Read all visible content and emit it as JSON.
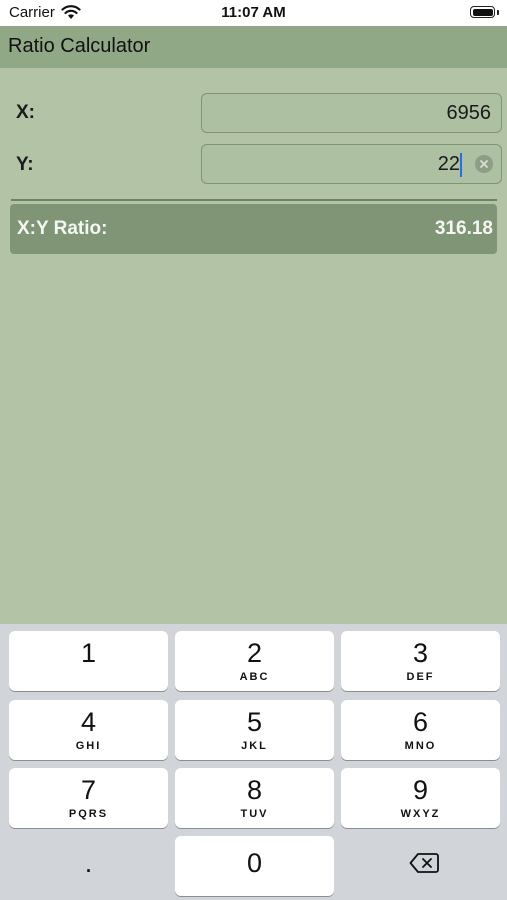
{
  "status_bar": {
    "carrier": "Carrier",
    "time": "11:07 AM"
  },
  "header": {
    "title": "Ratio Calculator"
  },
  "form": {
    "x": {
      "label": "X:",
      "value": "6956"
    },
    "y": {
      "label": "Y:",
      "value": "22"
    }
  },
  "result": {
    "label": "X:Y Ratio:",
    "value": "316.18"
  },
  "keyboard": {
    "keys": [
      {
        "num": "1",
        "letters": ""
      },
      {
        "num": "2",
        "letters": "ABC"
      },
      {
        "num": "3",
        "letters": "DEF"
      },
      {
        "num": "4",
        "letters": "GHI"
      },
      {
        "num": "5",
        "letters": "JKL"
      },
      {
        "num": "6",
        "letters": "MNO"
      },
      {
        "num": "7",
        "letters": "PQRS"
      },
      {
        "num": "8",
        "letters": "TUV"
      },
      {
        "num": "9",
        "letters": "WXYZ"
      },
      {
        "num": "0",
        "letters": ""
      }
    ],
    "decimal": ".",
    "delete_icon": "backspace-icon"
  },
  "colors": {
    "background": "#b2c3a6",
    "header": "#90a886",
    "result_bar": "#7f9576",
    "cursor": "#2a6be8"
  }
}
